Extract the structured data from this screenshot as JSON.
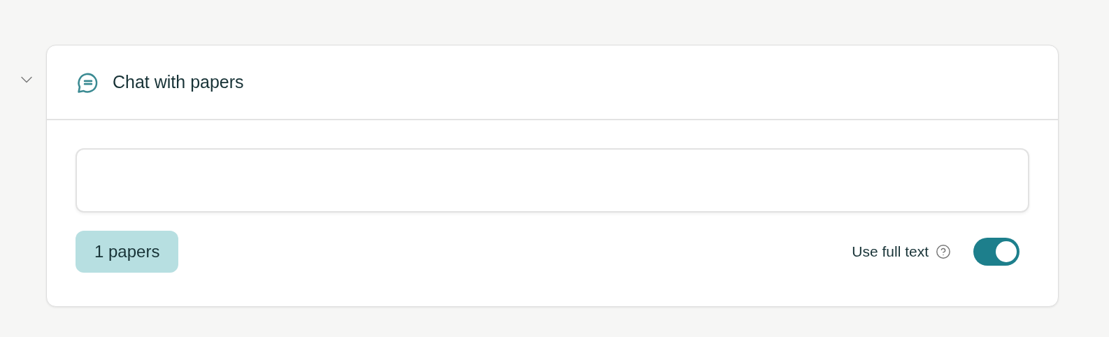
{
  "section": {
    "expanded": true
  },
  "panel": {
    "title": "Chat with papers"
  },
  "papers_chip": {
    "label": "1 papers"
  },
  "full_text_toggle": {
    "label": "Use full text",
    "on": true
  }
}
